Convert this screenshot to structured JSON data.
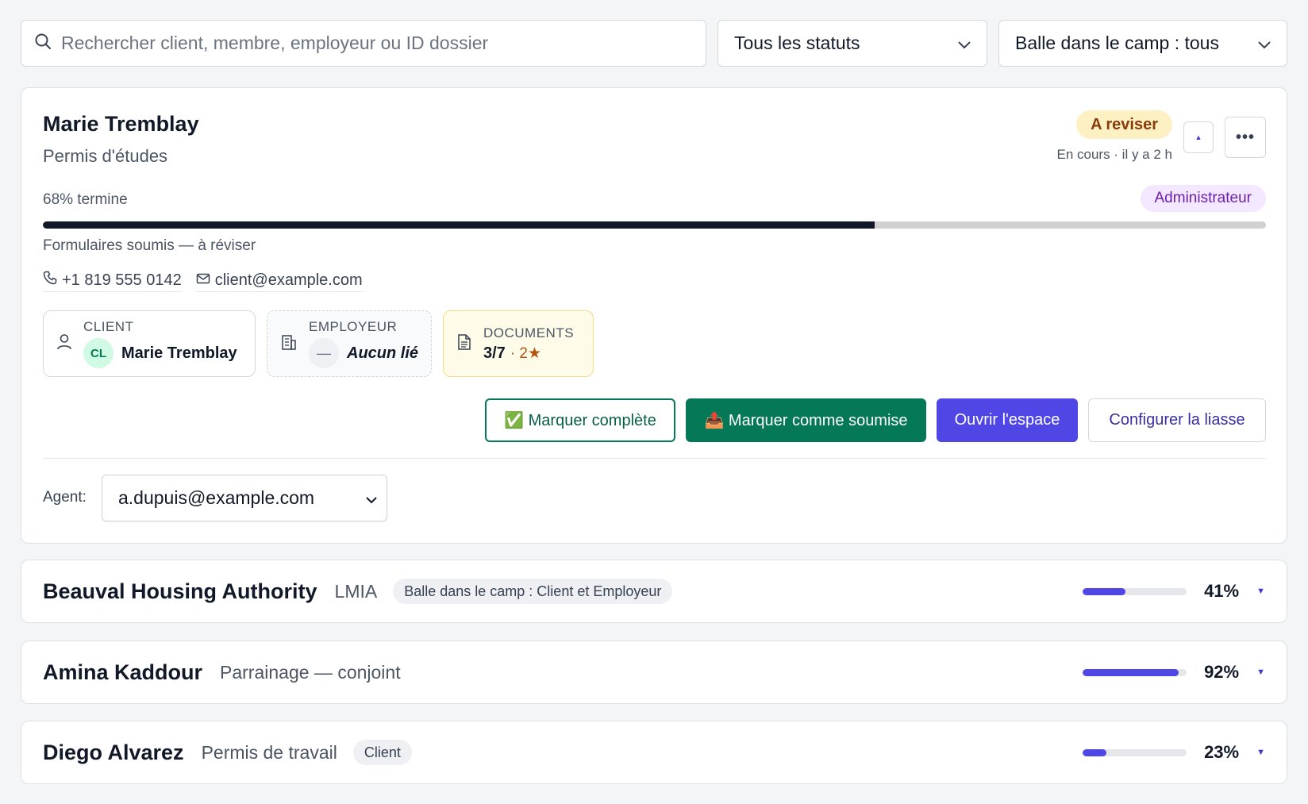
{
  "filters": {
    "search_placeholder": "Rechercher client, membre, employeur ou ID dossier",
    "status_select": "Tous les statuts",
    "ball_select": "Balle dans le camp : tous"
  },
  "expanded_case": {
    "name": "Marie Tremblay",
    "type": "Permis d'études",
    "status_badge": "A reviser",
    "status_line": "En cours · il y a 2 h",
    "progress_label": "68% termine",
    "progress_fraction": 0.68,
    "role_badge": "Administrateur",
    "stage": "Formulaires soumis — à réviser",
    "phone": "+1 819 555 0142",
    "email": "client@example.com",
    "client_tile": {
      "label": "CLIENT",
      "initials": "CL",
      "name": "Marie Tremblay"
    },
    "employer_tile": {
      "label": "EMPLOYEUR",
      "dash": "—",
      "value": "Aucun lié"
    },
    "documents_tile": {
      "label": "DOCUMENTS",
      "count": "3/7",
      "starred": "· 2★"
    },
    "actions": {
      "mark_complete": "✅ Marquer complète",
      "mark_submitted": "📤 Marquer comme soumise",
      "open_space": "Ouvrir l'espace",
      "configure": "Configurer la liasse"
    },
    "agent_label": "Agent:",
    "agent_value": "a.dupuis@example.com"
  },
  "cases": [
    {
      "name": "Beauval Housing Authority",
      "type": "LMIA",
      "tag": "Balle dans le camp : Client et Employeur",
      "percent_label": "41%",
      "progress": 0.41
    },
    {
      "name": "Amina Kaddour",
      "type": "Parrainage — conjoint",
      "tag": "",
      "percent_label": "92%",
      "progress": 0.92
    },
    {
      "name": "Diego Alvarez",
      "type": "Permis de travail",
      "tag": "Client",
      "percent_label": "23%",
      "progress": 0.23
    }
  ],
  "colors": {
    "accent": "#4f46e5",
    "success": "#047857",
    "warning_bg": "#fdf0c2",
    "warning_text": "#8a3b0a",
    "role_bg": "#f3e8ff",
    "role_text": "#6b21a8"
  },
  "icons": {
    "search": "search-icon",
    "chevron": "chevron-down-icon",
    "phone": "phone-icon",
    "mail": "mail-icon",
    "user": "user-icon",
    "building": "building-icon",
    "document": "document-icon",
    "more": "more-icon",
    "collapse": "collapse-icon"
  }
}
